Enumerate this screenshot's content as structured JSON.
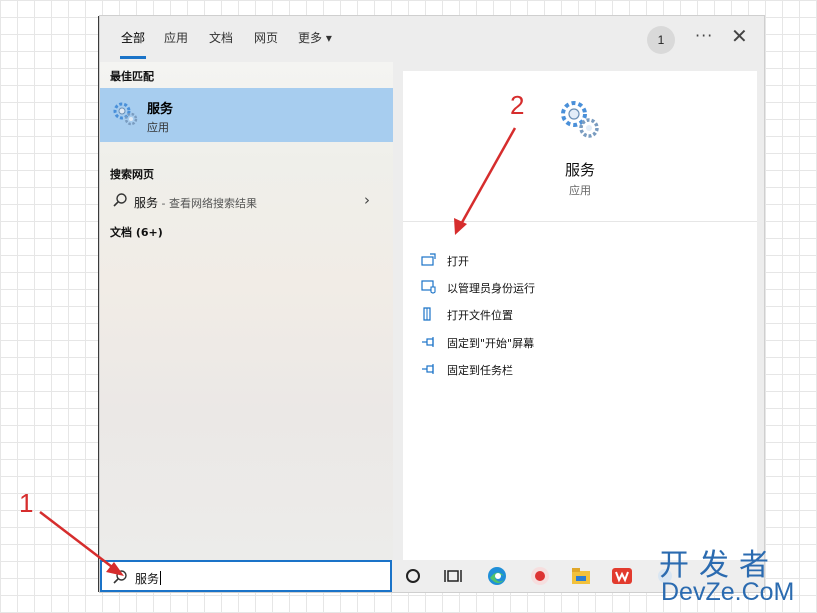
{
  "tabs": [
    {
      "label": "全部"
    },
    {
      "label": "应用"
    },
    {
      "label": "文档"
    },
    {
      "label": "网页"
    },
    {
      "label": "更多 ▾"
    }
  ],
  "toolbar": {
    "avatar_text": "1",
    "more_label": "···",
    "close_label": "✕"
  },
  "left": {
    "best_match_heading": "最佳匹配",
    "best_match": {
      "title": "服务",
      "subtitle": "应用",
      "icon": "gears-icon"
    },
    "web_heading": "搜索网页",
    "web_result": {
      "term": "服务",
      "suffix": " - 查看网络搜索结果"
    },
    "docs_heading": "文档 (6+)"
  },
  "right": {
    "title": "服务",
    "subtitle": "应用",
    "actions": [
      {
        "label": "打开",
        "icon": "open-icon"
      },
      {
        "label": "以管理员身份运行",
        "icon": "shield-run-icon"
      },
      {
        "label": "打开文件位置",
        "icon": "file-location-icon"
      },
      {
        "label": "固定到\"开始\"屏幕",
        "icon": "pin-icon"
      },
      {
        "label": "固定到任务栏",
        "icon": "pin-icon"
      }
    ]
  },
  "search": {
    "value": "服务"
  },
  "taskbar": {
    "items": [
      "cortana-icon",
      "task-view-icon",
      "edge-icon",
      "recorder-icon",
      "file-explorer-icon",
      "wps-icon",
      "tray-icon"
    ]
  },
  "annotations": {
    "label_1": "1",
    "label_2": "2",
    "color": "#d62d2d"
  },
  "watermark": {
    "line1": "开发者",
    "line2": "DevZe.CoM"
  },
  "colors": {
    "accent": "#1a73c8",
    "selection": "#a7cdef"
  }
}
